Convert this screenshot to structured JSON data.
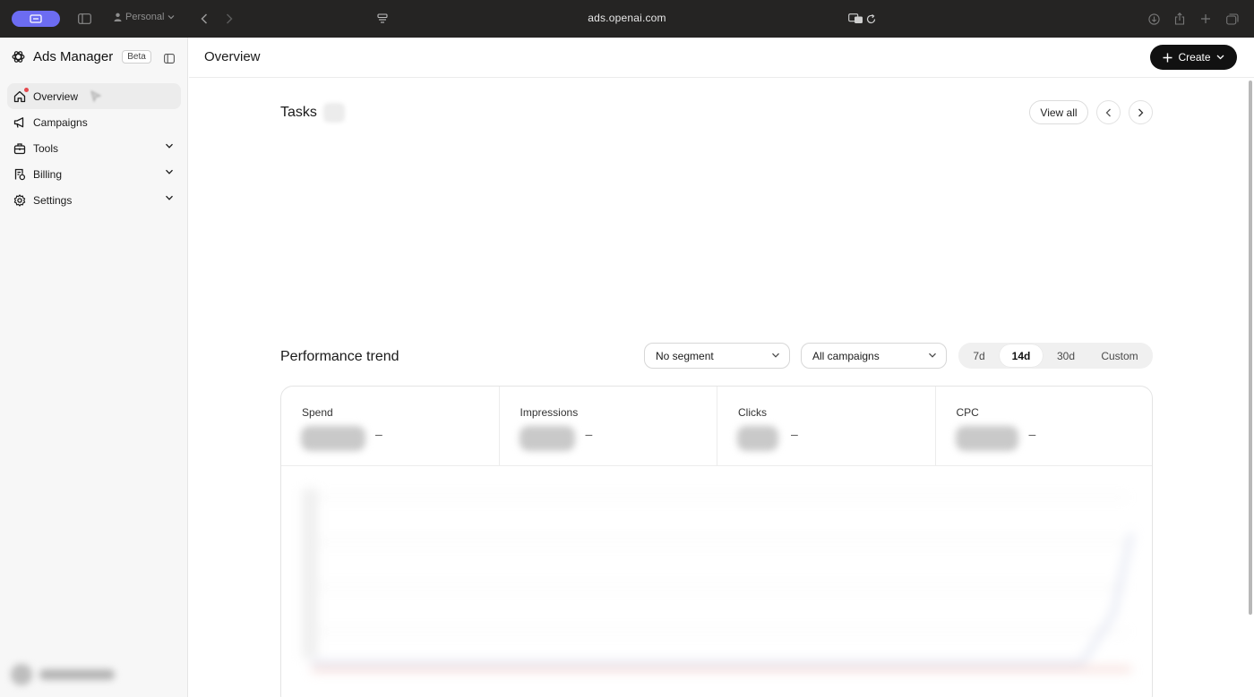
{
  "browser": {
    "profile": "Personal",
    "url": "ads.openai.com"
  },
  "sidebar": {
    "app_name": "Ads Manager",
    "badge": "Beta",
    "items": [
      {
        "label": "Overview",
        "icon": "home-icon",
        "active": true,
        "notification": true
      },
      {
        "label": "Campaigns",
        "icon": "megaphone-icon"
      },
      {
        "label": "Tools",
        "icon": "toolbox-icon",
        "expandable": true
      },
      {
        "label": "Billing",
        "icon": "receipt-icon",
        "expandable": true
      },
      {
        "label": "Settings",
        "icon": "gear-icon",
        "expandable": true
      }
    ]
  },
  "header": {
    "title": "Overview",
    "create_label": "Create"
  },
  "tasks": {
    "title": "Tasks",
    "view_all": "View all"
  },
  "performance": {
    "title": "Performance trend",
    "segment_select": "No segment",
    "campaign_select": "All campaigns",
    "ranges": [
      "7d",
      "14d",
      "30d",
      "Custom"
    ],
    "selected_range": "14d",
    "metrics": [
      {
        "label": "Spend",
        "change": "–"
      },
      {
        "label": "Impressions",
        "change": "–"
      },
      {
        "label": "Clicks",
        "change": "–"
      },
      {
        "label": "CPC",
        "change": "–"
      }
    ]
  },
  "colors": {
    "accent_pill": "#6c6cf2",
    "primary_button": "#111111",
    "notification_dot": "#e5484d"
  }
}
